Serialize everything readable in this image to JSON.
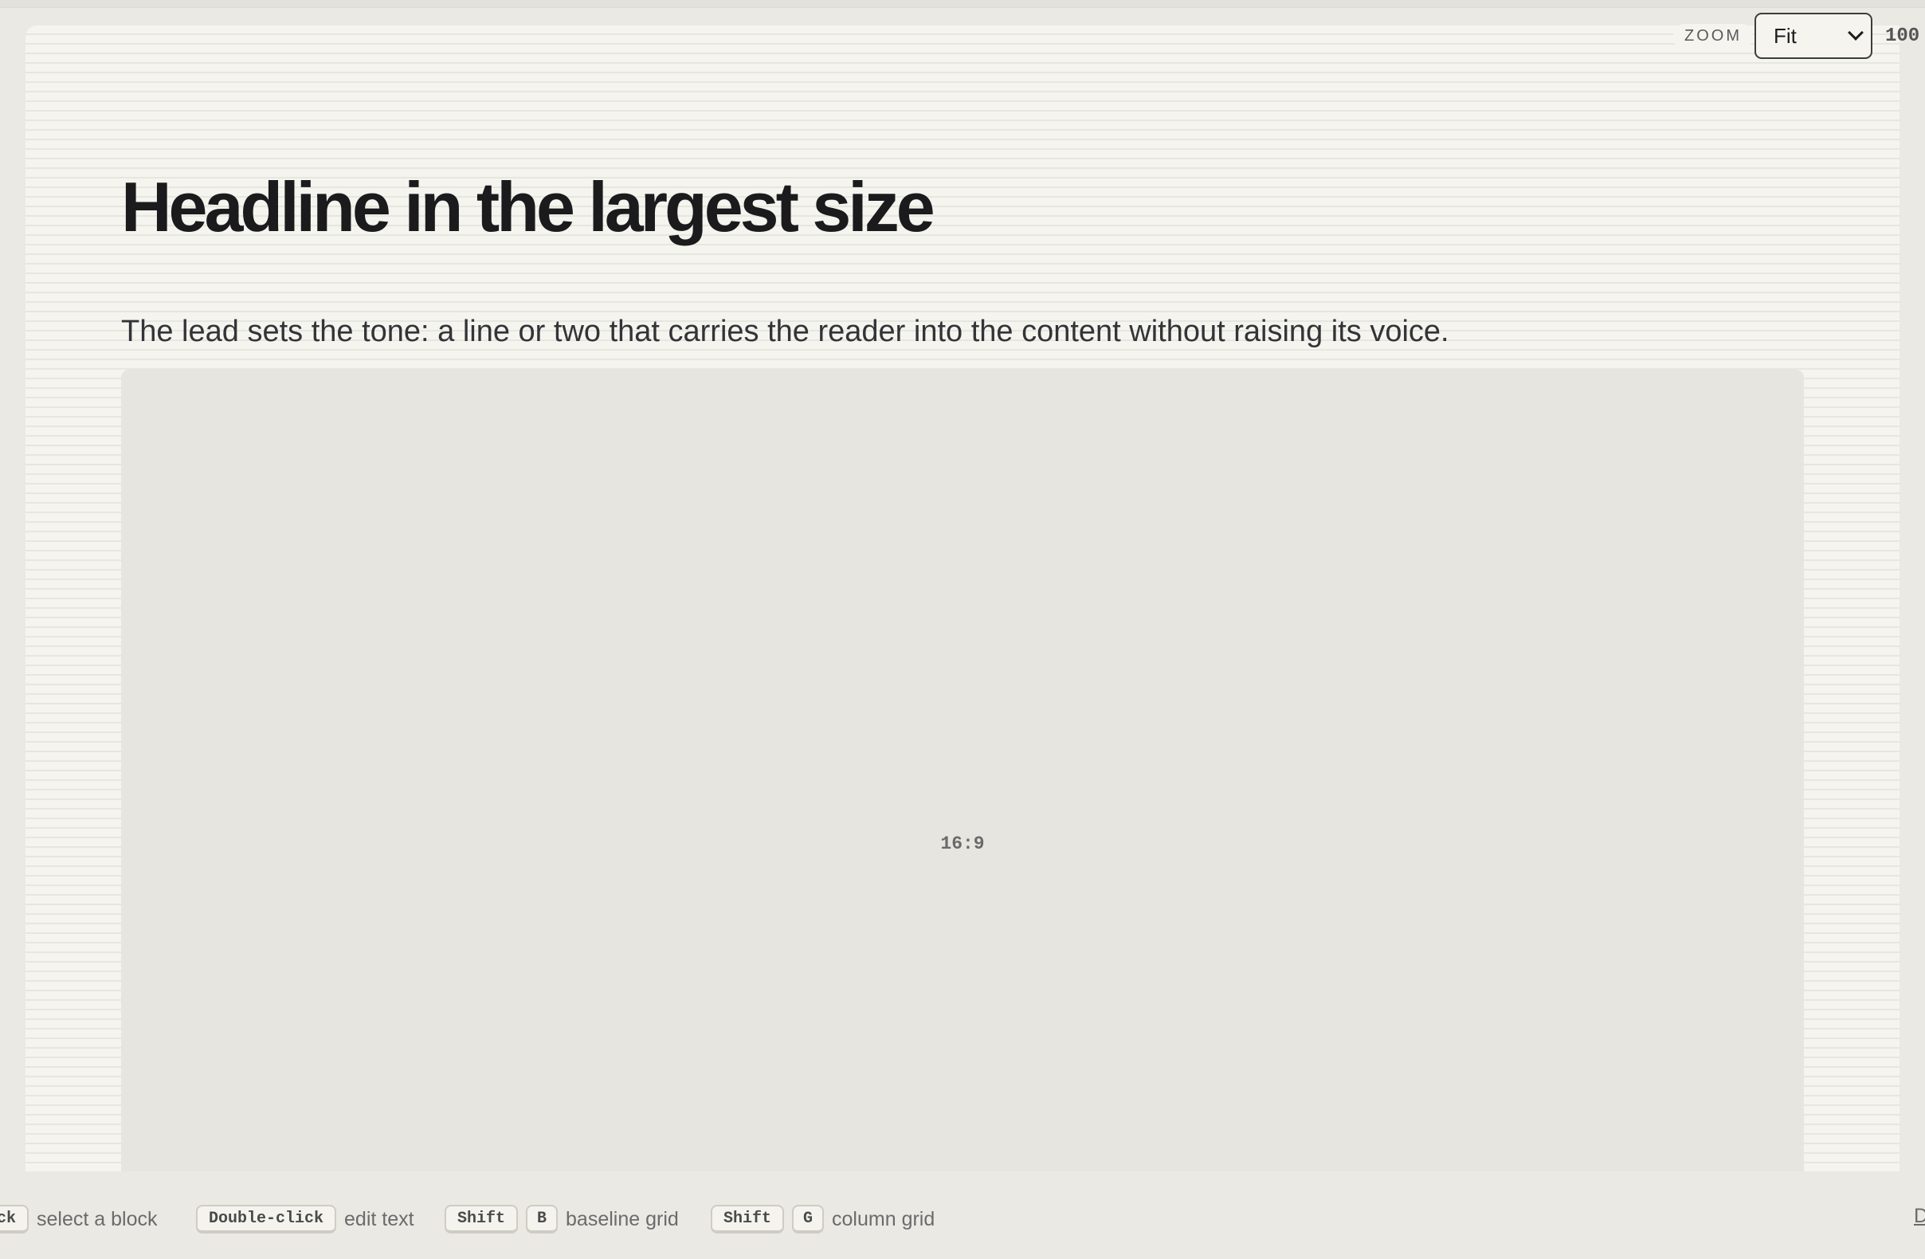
{
  "canvas": {
    "headline": "Headline in the largest size",
    "lead": "The lead sets the tone: a line or two that carries the reader into the content without raising its voice.",
    "media": {
      "aspect_label": "16:9"
    }
  },
  "zoom": {
    "label": "ZOOM",
    "selected": "Fit",
    "value": "100"
  },
  "help_bar": {
    "hints": [
      {
        "keys": [
          "ick"
        ],
        "text": "select a block"
      },
      {
        "keys": [
          "Double-click"
        ],
        "text": "edit text"
      },
      {
        "keys": [
          "Shift",
          "B"
        ],
        "text": "baseline grid"
      },
      {
        "keys": [
          "Shift",
          "G"
        ],
        "text": "column grid"
      }
    ],
    "right_link": "D"
  },
  "colors": {
    "page_background": "#ebe9e3",
    "canvas_background": "#f5f4ef",
    "baseline_grid_line": "#e4e8df",
    "media_placeholder": "#e7e5df",
    "headline_text": "#1b1b1d"
  }
}
